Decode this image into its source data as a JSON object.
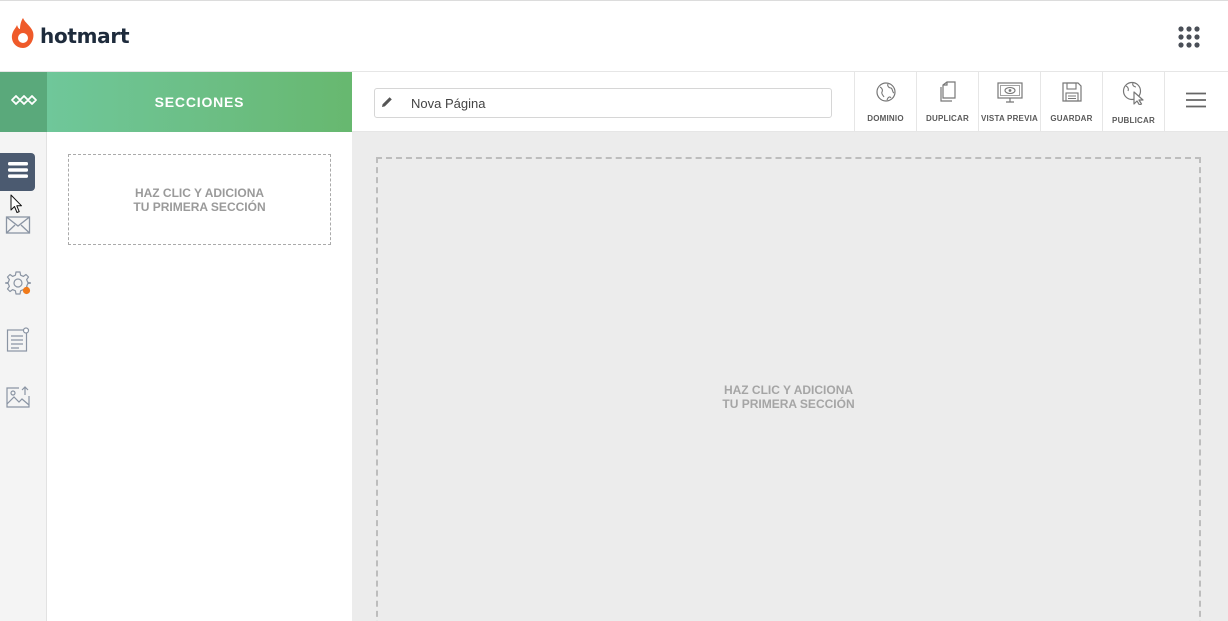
{
  "app": {
    "brand": "hotmart"
  },
  "colors": {
    "brand_orange": "#ef5a2a",
    "green": "#6cbf86",
    "rail_active": "#4b5a70",
    "notify": "#f07a1a"
  },
  "sidebar": {
    "title": "SECCIONES",
    "rail_items": [
      {
        "icon": "sections-list-icon",
        "active": true
      },
      {
        "icon": "mail-icon"
      },
      {
        "icon": "settings-gear-icon",
        "badge": true
      },
      {
        "icon": "form-icon"
      },
      {
        "icon": "image-upload-icon"
      }
    ]
  },
  "panel": {
    "empty_line1": "HAZ CLIC Y ADICIONA",
    "empty_line2": "TU PRIMERA SECCIÓN"
  },
  "toolbar": {
    "page_name": "Nova Página",
    "tools": [
      {
        "label": "DOMINIO",
        "icon": "globe-icon"
      },
      {
        "label": "DUPLICAR",
        "icon": "duplicate-icon"
      },
      {
        "label": "VISTA PREVIA",
        "icon": "preview-monitor-icon"
      },
      {
        "label": "GUARDAR",
        "icon": "save-disk-icon"
      },
      {
        "label": "PUBLICAR",
        "icon": "publish-cursor-icon"
      }
    ]
  },
  "canvas": {
    "empty_line1": "HAZ CLIC Y ADICIONA",
    "empty_line2": "TU PRIMERA SECCIÓN"
  }
}
